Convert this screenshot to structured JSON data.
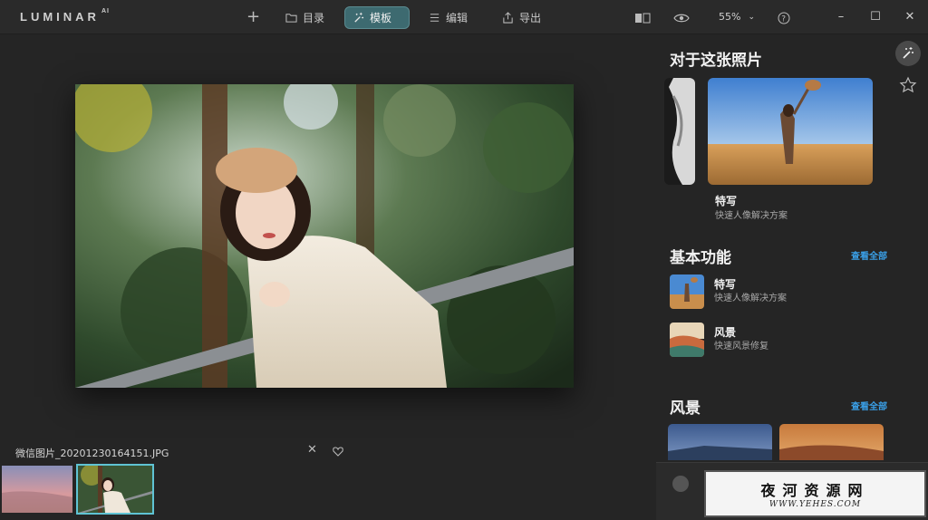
{
  "app": {
    "logo": "LUMINAR",
    "logo_sup": "AI"
  },
  "toolbar": {
    "add": "+",
    "catalog": "目录",
    "templates": "模板",
    "edit": "编辑",
    "export": "导出",
    "zoom": "55%"
  },
  "file": {
    "name": "微信图片_20201230164151.JPG"
  },
  "panel": {
    "section1_title": "对于这张照片",
    "feature": {
      "title": "特写",
      "sub": "快速人像解决方案"
    },
    "section2_title": "基本功能",
    "see_all_1": "查看全部",
    "item1": {
      "title": "特写",
      "sub": "快速人像解决方案"
    },
    "item2": {
      "title": "风景",
      "sub": "快速风景修复"
    },
    "section3_title": "风景",
    "see_all_2": "查看全部"
  },
  "watermark": {
    "cn": "夜河资源网",
    "url": "WWW.YEHES.COM"
  },
  "colors": {
    "accent": "#3d6a70",
    "link": "#3aa0e8",
    "selection": "#5fc3d4"
  }
}
